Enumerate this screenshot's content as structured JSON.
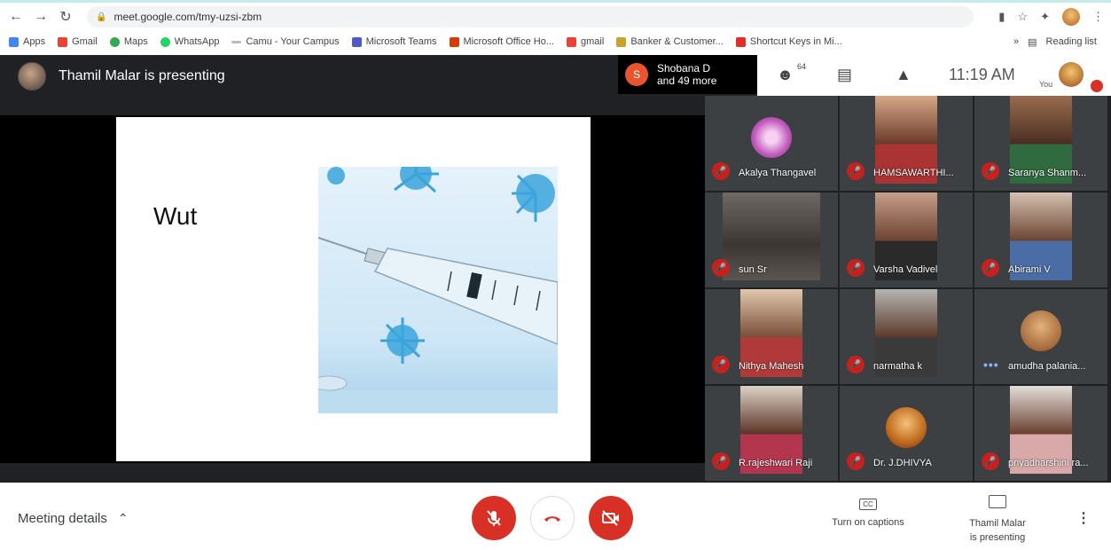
{
  "browser": {
    "url": "meet.google.com/tmy-uzsi-zbm",
    "bookmarks": [
      "Apps",
      "Gmail",
      "Maps",
      "WhatsApp",
      "Camu - Your Campus",
      "Microsoft Teams",
      "Microsoft Office Ho...",
      "gmail",
      "Banker & Customer...",
      "Shortcut Keys in Mi..."
    ],
    "reading_list": "Reading list"
  },
  "meet": {
    "presenter_text": "Thamil Malar is presenting",
    "chip": {
      "letter": "S",
      "line1": "Shobana D",
      "line2": "and 49 more"
    },
    "people_count": "64",
    "time": "11:19 AM",
    "you_label": "You",
    "slide_word": "Wut"
  },
  "tiles": [
    {
      "name": "Akalya Thangavel"
    },
    {
      "name": "HAMSAWARTHI..."
    },
    {
      "name": "Saranya Shanm..."
    },
    {
      "name": "sun Sr"
    },
    {
      "name": "Varsha Vadivel"
    },
    {
      "name": "Abirami V"
    },
    {
      "name": "Nithya Mahesh"
    },
    {
      "name": "narmatha k"
    },
    {
      "name": "amudha palania..."
    },
    {
      "name": "R.rajeshwari Raji"
    },
    {
      "name": "Dr. J.DHIVYA"
    },
    {
      "name": "priyadharshini ra..."
    }
  ],
  "bottom": {
    "meeting_details": "Meeting details",
    "captions": "Turn on captions",
    "cc": "CC",
    "present_line1": "Thamil Malar",
    "present_line2": "is presenting"
  },
  "colors": {
    "mute_red": "#c5221f",
    "control_red": "#d93025",
    "tile_bg": "#3c4043",
    "meet_bg": "#202124"
  }
}
